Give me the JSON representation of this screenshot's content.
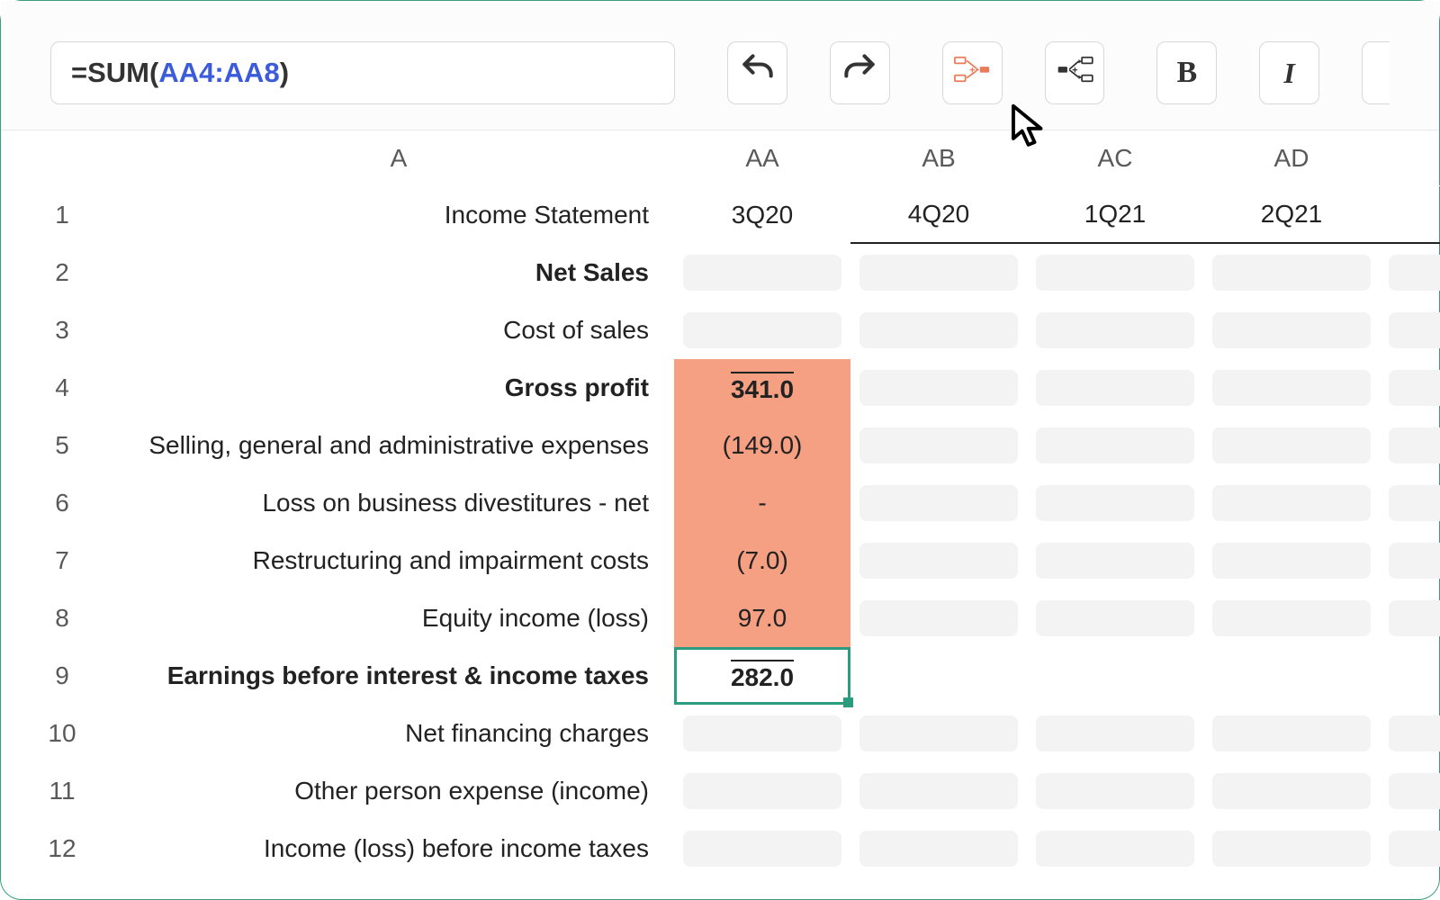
{
  "formula": {
    "eq": "=",
    "fn": "SUM",
    "open": "(",
    "ref": "AA4:AA8",
    "close": ")"
  },
  "toolbar": {
    "bold_label": "B",
    "italic_label": "I"
  },
  "columns": {
    "a": "A",
    "aa": "AA",
    "ab": "AB",
    "ac": "AC",
    "ad": "AD",
    "ae": ""
  },
  "rownum": {
    "r1": "1",
    "r2": "2",
    "r3": "3",
    "r4": "4",
    "r5": "5",
    "r6": "6",
    "r7": "7",
    "r8": "8",
    "r9": "9",
    "r10": "10",
    "r11": "11",
    "r12": "12"
  },
  "rows": {
    "r1": {
      "label": "Income Statement",
      "aa": "3Q20",
      "ab": "4Q20",
      "ac": "1Q21",
      "ad": "2Q21"
    },
    "r2": {
      "label": "Net Sales"
    },
    "r3": {
      "label": "Cost of sales"
    },
    "r4": {
      "label": "Gross profit",
      "aa": "341.0"
    },
    "r5": {
      "label": "Selling, general and administrative expenses",
      "aa": "(149.0)"
    },
    "r6": {
      "label": "Loss on business divestitures - net",
      "aa": "-"
    },
    "r7": {
      "label": "Restructuring and impairment costs",
      "aa": "(7.0)"
    },
    "r8": {
      "label": "Equity income (loss)",
      "aa": "97.0"
    },
    "r9": {
      "label": "Earnings before interest & income taxes",
      "aa": "282.0"
    },
    "r10": {
      "label": "Net financing charges"
    },
    "r11": {
      "label": "Other person expense (income)"
    },
    "r12": {
      "label": "Income (loss) before income taxes"
    }
  },
  "chart_data": {
    "type": "table",
    "title": "Income Statement",
    "columns": [
      "3Q20",
      "4Q20",
      "1Q21",
      "2Q21"
    ],
    "rows": [
      {
        "label": "Net Sales",
        "values": [
          null,
          null,
          null,
          null
        ]
      },
      {
        "label": "Cost of sales",
        "values": [
          null,
          null,
          null,
          null
        ]
      },
      {
        "label": "Gross profit",
        "values": [
          341.0,
          null,
          null,
          null
        ]
      },
      {
        "label": "Selling, general and administrative expenses",
        "values": [
          -149.0,
          null,
          null,
          null
        ]
      },
      {
        "label": "Loss on business divestitures - net",
        "values": [
          0,
          null,
          null,
          null
        ]
      },
      {
        "label": "Restructuring and impairment costs",
        "values": [
          -7.0,
          null,
          null,
          null
        ]
      },
      {
        "label": "Equity income (loss)",
        "values": [
          97.0,
          null,
          null,
          null
        ]
      },
      {
        "label": "Earnings before interest & income taxes",
        "values": [
          282.0,
          null,
          null,
          null
        ]
      },
      {
        "label": "Net financing charges",
        "values": [
          null,
          null,
          null,
          null
        ]
      },
      {
        "label": "Other person expense (income)",
        "values": [
          null,
          null,
          null,
          null
        ]
      },
      {
        "label": "Income (loss) before income taxes",
        "values": [
          null,
          null,
          null,
          null
        ]
      }
    ],
    "selected_cell": "AA9",
    "selected_range": "AA4:AA8",
    "formula": "=SUM(AA4:AA8)"
  }
}
